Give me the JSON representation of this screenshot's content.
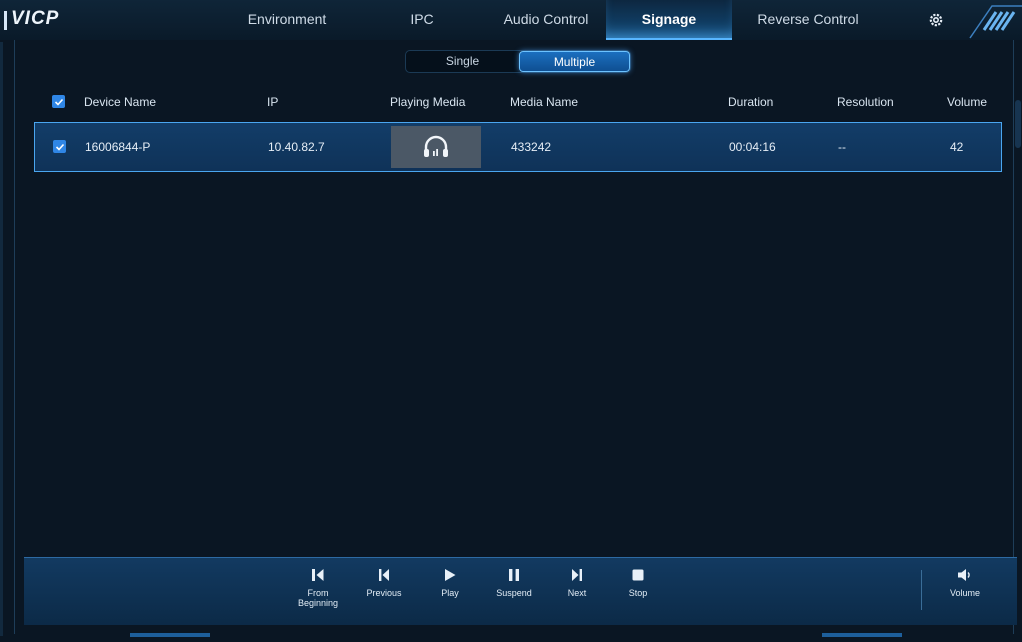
{
  "header": {
    "logo": "VICP",
    "tabs": [
      {
        "label": "Environment",
        "active": false
      },
      {
        "label": "IPC",
        "active": false
      },
      {
        "label": "Audio Control",
        "active": false
      },
      {
        "label": "Signage",
        "active": true
      },
      {
        "label": "Reverse Control",
        "active": false
      }
    ],
    "settings_icon": "gear-icon"
  },
  "mode_toggle": {
    "options": [
      "Single",
      "Multiple"
    ],
    "selected": "Multiple"
  },
  "table": {
    "columns": [
      "Device Name",
      "IP",
      "Playing Media",
      "Media Name",
      "Duration",
      "Resolution",
      "Volume"
    ],
    "select_all_checked": true,
    "rows": [
      {
        "checked": true,
        "device_name": "16006844-P",
        "ip": "10.40.82.7",
        "playing_media_icon": "headphones-icon",
        "media_name": "433242",
        "duration": "00:04:16",
        "resolution": "--",
        "volume": "42"
      }
    ]
  },
  "controls": {
    "from_beginning": "From Beginning",
    "previous": "Previous",
    "play": "Play",
    "suspend": "Suspend",
    "next": "Next",
    "stop": "Stop",
    "volume": "Volume"
  },
  "colors": {
    "background": "#0a1623",
    "accent": "#2f86e6",
    "selected_row": "#123d68"
  }
}
